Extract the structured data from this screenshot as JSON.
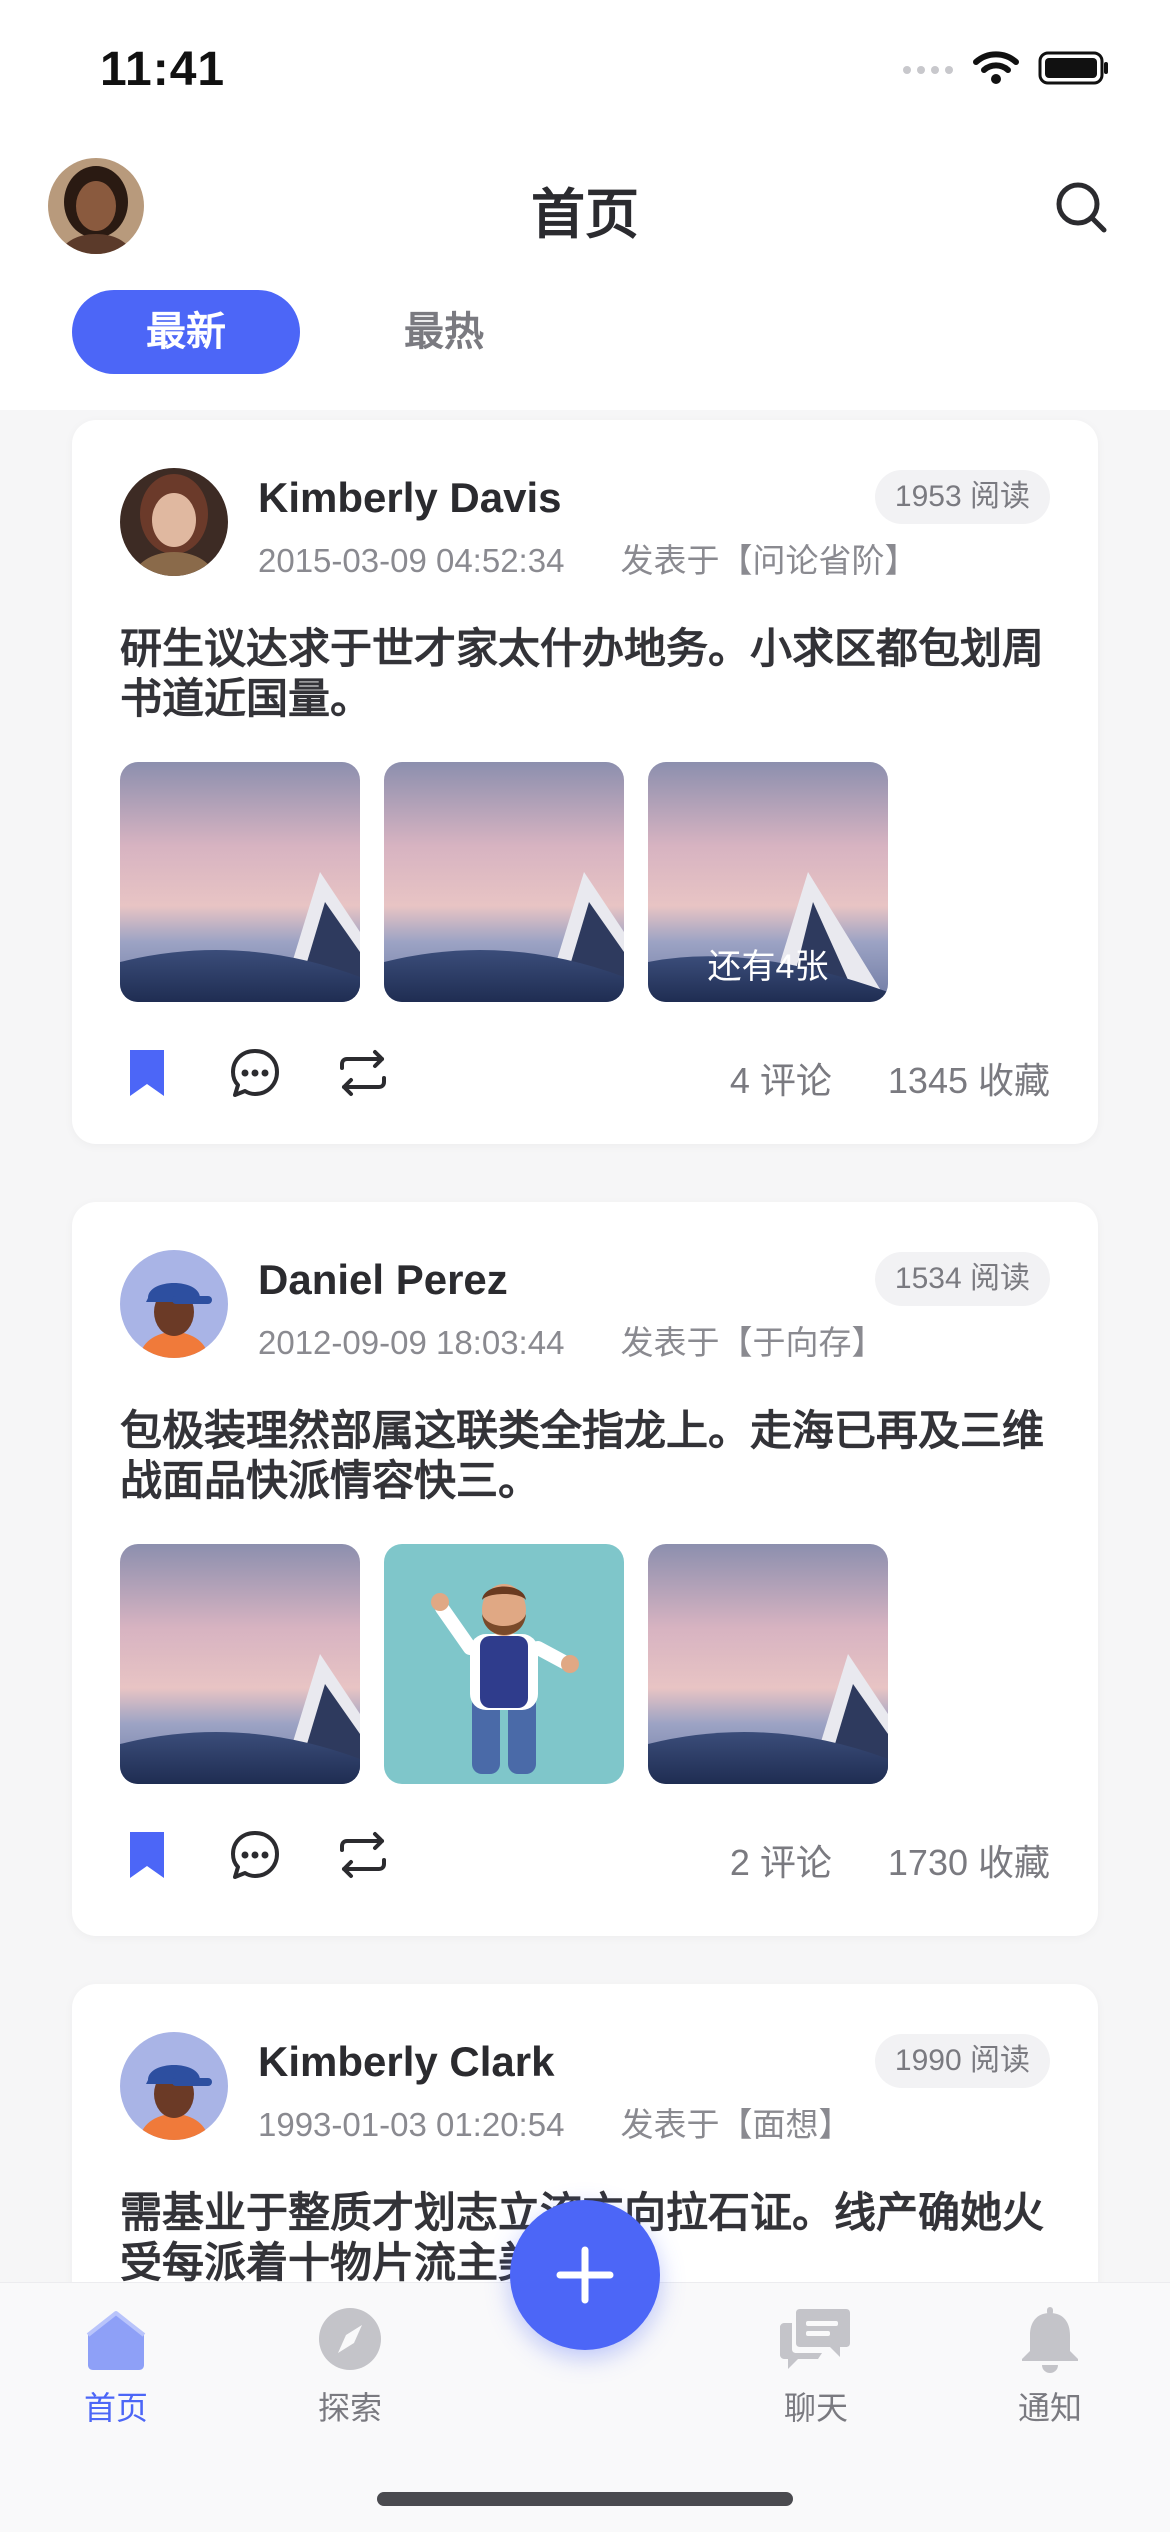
{
  "status_bar": {
    "time": "11:41"
  },
  "header": {
    "title": "首页"
  },
  "tabs": [
    {
      "label": "最新",
      "active": true
    },
    {
      "label": "最热",
      "active": false
    }
  ],
  "posts": [
    {
      "author": "Kimberly Davis",
      "time": "2015-03-09 04:52:34",
      "posted_in": "发表于【问论省阶】",
      "reads": "1953 阅读",
      "text": "研生议达求于世才家太什办地务。小求区都包划周书道近国量。",
      "images": [
        "mountain",
        "mountain",
        "mountain"
      ],
      "more_images": "还有4张",
      "comments": "4 评论",
      "favorites": "1345 收藏"
    },
    {
      "author": "Daniel Perez",
      "time": "2012-09-09 18:03:44",
      "posted_in": "发表于【于向存】",
      "reads": "1534 阅读",
      "text": "包极装理然部属这联类全指龙上。走海已再及三维战面品快派情容快三。",
      "images": [
        "mountain",
        "character",
        "mountain"
      ],
      "comments": "2 评论",
      "favorites": "1730 收藏"
    },
    {
      "author": "Kimberly Clark",
      "time": "1993-01-03 01:20:54",
      "posted_in": "发表于【面想】",
      "reads": "1990 阅读",
      "text": "需基业于整质才划志立流方向拉石证。线产确她火受每派着十物片流主美。"
    }
  ],
  "bottom_nav": [
    {
      "label": "首页",
      "icon": "home-icon",
      "active": true
    },
    {
      "label": "探索",
      "icon": "compass-icon",
      "active": false
    },
    {
      "label": "聊天",
      "icon": "chat-icon",
      "active": false
    },
    {
      "label": "通知",
      "icon": "bell-icon",
      "active": false
    }
  ],
  "colors": {
    "accent": "#4c66f7",
    "text": "#2b2b2f",
    "muted": "#7a7a80",
    "background": "#f6f6f7"
  }
}
